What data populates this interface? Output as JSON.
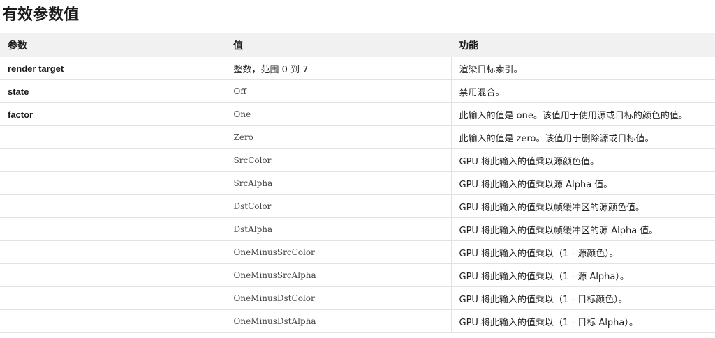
{
  "title": "有效参数值",
  "table": {
    "headers": [
      "参数",
      "值",
      "功能"
    ],
    "rows": [
      {
        "param": "render target",
        "value": "整数，范围 0 到 7",
        "value_is_code": false,
        "description": "渲染目标索引。"
      },
      {
        "param": "state",
        "value": "Off",
        "value_is_code": true,
        "description": "禁用混合。"
      },
      {
        "param": "factor",
        "value": "One",
        "value_is_code": true,
        "description": "此输入的值是 one。该值用于使用源或目标的颜色的值。"
      },
      {
        "param": "",
        "value": "Zero",
        "value_is_code": true,
        "description": "此输入的值是 zero。该值用于删除源或目标值。"
      },
      {
        "param": "",
        "value": "SrcColor",
        "value_is_code": true,
        "description": "GPU 将此输入的值乘以源颜色值。"
      },
      {
        "param": "",
        "value": "SrcAlpha",
        "value_is_code": true,
        "description": "GPU 将此输入的值乘以源 Alpha 值。"
      },
      {
        "param": "",
        "value": "DstColor",
        "value_is_code": true,
        "description": "GPU 将此输入的值乘以帧缓冲区的源颜色值。"
      },
      {
        "param": "",
        "value": "DstAlpha",
        "value_is_code": true,
        "description": "GPU 将此输入的值乘以帧缓冲区的源 Alpha 值。"
      },
      {
        "param": "",
        "value": "OneMinusSrcColor",
        "value_is_code": true,
        "description": "GPU 将此输入的值乘以（1 - 源颜色）。"
      },
      {
        "param": "",
        "value": "OneMinusSrcAlpha",
        "value_is_code": true,
        "description": "GPU 将此输入的值乘以（1 - 源 Alpha）。"
      },
      {
        "param": "",
        "value": "OneMinusDstColor",
        "value_is_code": true,
        "description": "GPU 将此输入的值乘以（1 - 目标颜色）。"
      },
      {
        "param": "",
        "value": "OneMinusDstAlpha",
        "value_is_code": true,
        "description": "GPU 将此输入的值乘以（1 - 目标 Alpha）。"
      }
    ]
  }
}
